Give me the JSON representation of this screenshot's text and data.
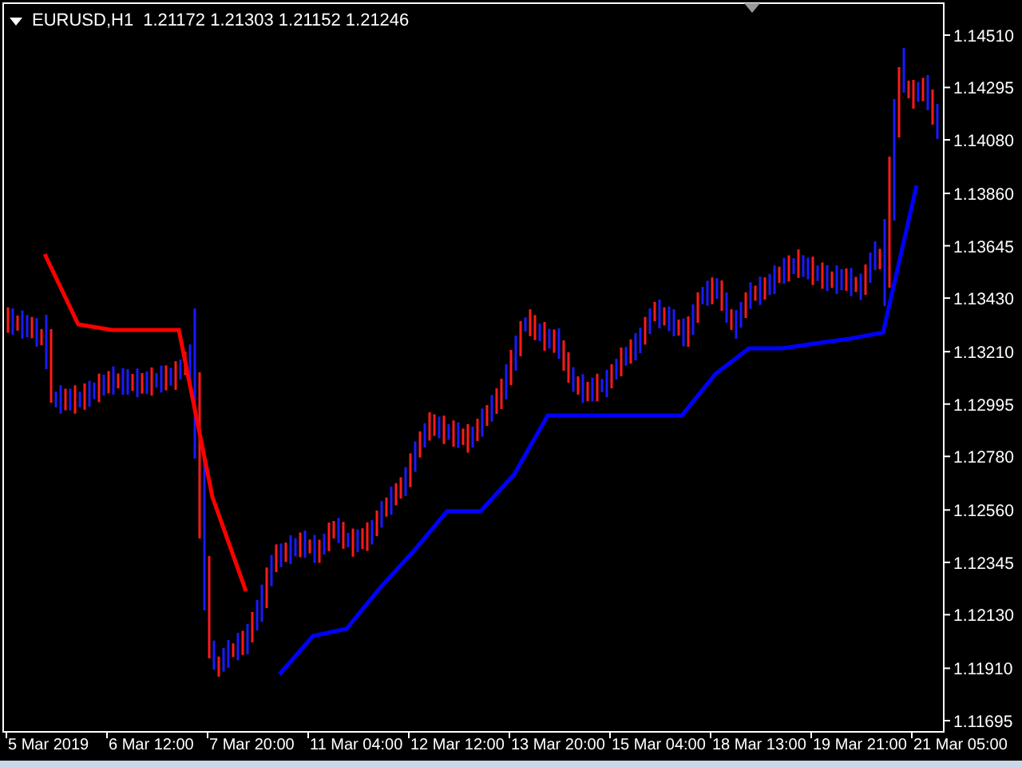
{
  "chart": {
    "symbol": "EURUSD,H1",
    "quote": "1.21172 1.21303 1.21152 1.21246",
    "chart_data": {
      "type": "line",
      "categories": [
        "5 Mar 2019",
        null,
        null,
        "6 Mar 12:00",
        null,
        null,
        "7 Mar 20:00",
        null,
        null,
        "11 Mar 04:00",
        null,
        null,
        "12 Mar 12:00",
        null,
        null,
        "13 Mar 20:00",
        null,
        null,
        "15 Mar 04:00",
        null,
        null,
        "18 Mar 13:00",
        null,
        null,
        "19 Mar 21:00",
        null,
        null,
        "21 Mar 05:00"
      ],
      "series": [
        {
          "color": "#ff0000",
          "values": [
            1.13611,
            1.13322,
            1.13299,
            1.13299,
            1.13299,
            1.12614,
            1.12227,
            null,
            null,
            null,
            null,
            null,
            null,
            null,
            null,
            null,
            null,
            null,
            null,
            null,
            null,
            null,
            null,
            null,
            null,
            null,
            null,
            null
          ]
        },
        {
          "color": "#0000ff",
          "values": [
            null,
            null,
            null,
            null,
            null,
            null,
            null,
            1.11885,
            1.12043,
            1.12072,
            1.1224,
            1.12391,
            1.12555,
            1.12555,
            1.12706,
            1.12948,
            1.12948,
            1.12948,
            1.12948,
            1.12948,
            1.13119,
            1.13224,
            1.13224,
            1.13244,
            1.13263,
            1.13289,
            1.13893,
            null
          ]
        }
      ],
      "ylim": [
        1.11649,
        1.14641
      ],
      "yticks": [
        {
          "value": 1.1451,
          "label": "1.14510"
        },
        {
          "value": 1.14295,
          "label": "1.14295"
        },
        {
          "value": 1.1408,
          "label": "1.14080"
        },
        {
          "value": 1.1386,
          "label": "1.13860"
        },
        {
          "value": 1.13645,
          "label": "1.13645"
        },
        {
          "value": 1.1343,
          "label": "1.13430"
        },
        {
          "value": 1.1321,
          "label": "1.13210"
        },
        {
          "value": 1.12995,
          "label": "1.12995"
        },
        {
          "value": 1.1278,
          "label": "1.12780"
        },
        {
          "value": 1.1256,
          "label": "1.12560"
        },
        {
          "value": 1.12345,
          "label": "1.12345"
        },
        {
          "value": 1.1213,
          "label": "1.12130"
        },
        {
          "value": 1.1191,
          "label": "1.11910"
        },
        {
          "value": 1.11695,
          "label": "1.11695"
        }
      ]
    }
  }
}
